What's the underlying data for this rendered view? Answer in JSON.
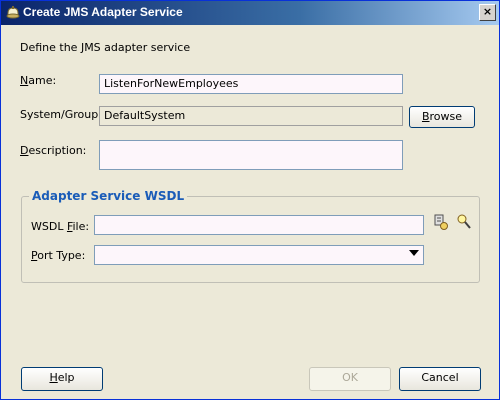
{
  "window": {
    "title": "Create JMS Adapter Service",
    "close_label": "×"
  },
  "form": {
    "intro": "Define the JMS adapter service",
    "name_label": "Name:",
    "name_value": "ListenForNewEmployees",
    "system_label": "System/Group:",
    "system_value": "DefaultSystem",
    "browse_label": "Browse",
    "description_label": "Description:",
    "description_value": ""
  },
  "wsdl": {
    "group_title": "Adapter Service WSDL",
    "file_label": "WSDL File:",
    "file_value": "",
    "port_type_label": "Port Type:",
    "port_type_value": ""
  },
  "buttons": {
    "help": "Help",
    "ok": "OK",
    "cancel": "Cancel"
  }
}
